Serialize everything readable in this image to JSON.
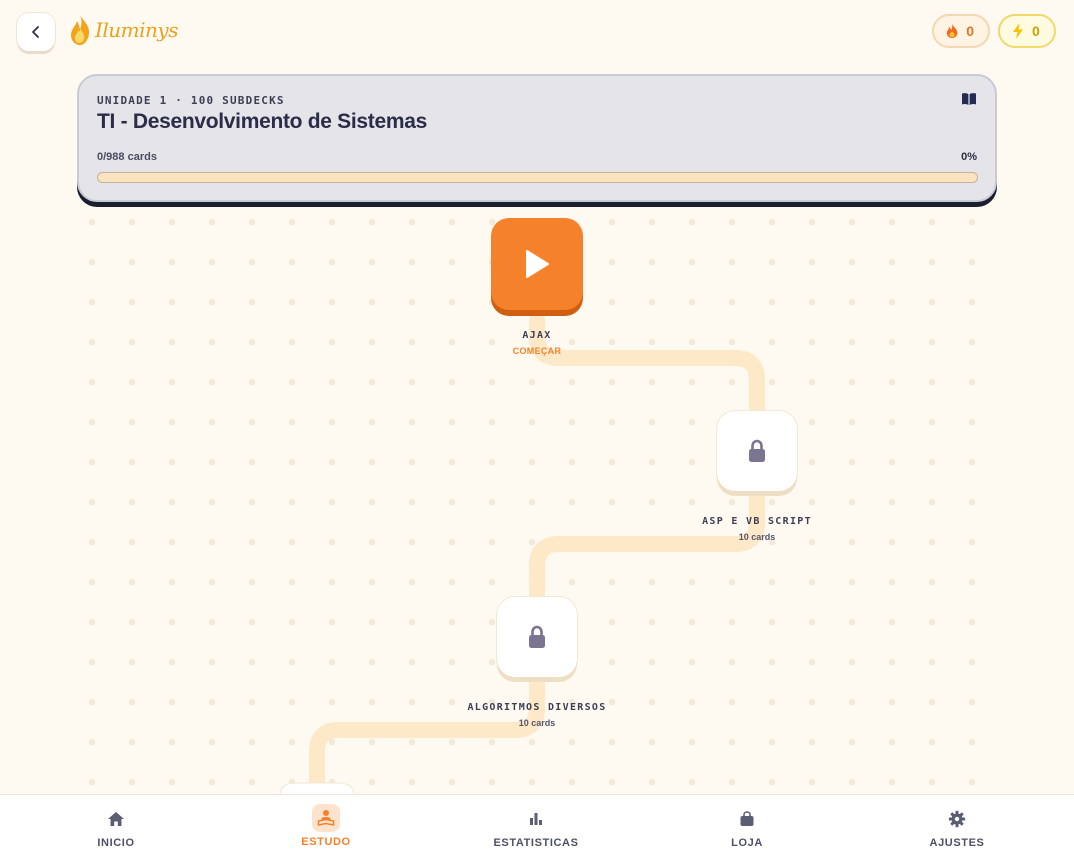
{
  "brand": {
    "name": "Iluminys",
    "icon": "flame-logo-icon",
    "color": "#e9a21c"
  },
  "header": {
    "back_icon": "chevron-left-icon",
    "streak": {
      "icon": "fire-icon",
      "value": "0",
      "color": "#e8731f"
    },
    "energy": {
      "icon": "lightning-icon",
      "value": "0",
      "color": "#f5c400"
    }
  },
  "unit": {
    "meta": "UNIDADE 1 · 100 SUBDECKS",
    "title": "TI - Desenvolvimento de Sistemas",
    "progress_text": "0/988 cards",
    "percent_text": "0%",
    "progress_value": 0,
    "book_icon": "book-icon"
  },
  "path": [
    {
      "name": "AJAX",
      "sub": "COMEÇAR",
      "state": "active",
      "icon": "play-icon"
    },
    {
      "name": "ASP E VB SCRIPT",
      "sub": "10 cards",
      "state": "locked",
      "icon": "lock-icon"
    },
    {
      "name": "ALGORITMOS DIVERSOS",
      "sub": "10 cards",
      "state": "locked",
      "icon": "lock-icon"
    }
  ],
  "nav": [
    {
      "label": "INICIO",
      "icon": "home-icon",
      "active": false
    },
    {
      "label": "ESTUDO",
      "icon": "study-icon",
      "active": true
    },
    {
      "label": "ESTATISTICAS",
      "icon": "bar-chart-icon",
      "active": false
    },
    {
      "label": "LOJA",
      "icon": "shopping-bag-icon",
      "active": false
    },
    {
      "label": "AJUSTES",
      "icon": "gear-icon",
      "active": false
    }
  ],
  "colors": {
    "accent": "#f5822a",
    "background": "#fef9f1",
    "path": "#fde8c8",
    "dark": "#2b2d48"
  }
}
